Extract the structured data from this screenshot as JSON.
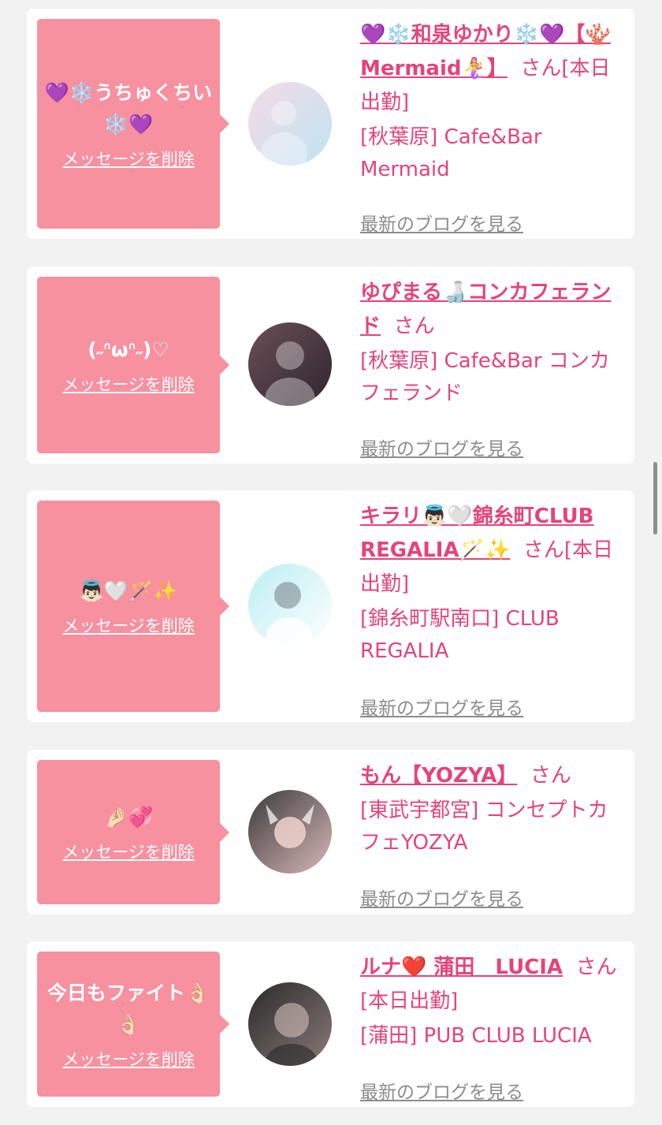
{
  "delete_label": "メッセージを削除",
  "blog_label": "最新のブログを見る",
  "items": [
    {
      "message": "💜❄️うちゅくちい❄️💜",
      "name": "💜❄️和泉ゆかり❄️💜【🪸Mermaid🧜‍♀️】",
      "suffix": "さん[本日出勤]",
      "shop": "[秋葉原] Cafe&Bar Mermaid"
    },
    {
      "message": "(˶ᐢωᐢ˶)♡",
      "name": "ゆぴまる🍶コンカフェランド",
      "suffix": "さん",
      "shop": "[秋葉原] Cafe&Bar コンカフェランド"
    },
    {
      "message": "👼🏻🤍🪄✨",
      "name": "キラリ👼🏻🤍錦糸町CLUB REGALIA🪄✨",
      "suffix": "さん[本日出勤]",
      "shop": "[錦糸町駅南口] CLUB REGALIA"
    },
    {
      "message": "🤌🏻💞",
      "name": "もん【YOZYA】",
      "suffix": "さん",
      "shop": "[東武宇都宮] コンセプトカフェYOZYA"
    },
    {
      "message": "今日もファイト👌🏻👌🏻",
      "name": "ルナ❤️ 蒲田　LUCIA",
      "suffix": "さん[本日出勤]",
      "shop": "[蒲田] PUB CLUB LUCIA"
    }
  ],
  "colors": {
    "bubble": "#f7909f",
    "accent": "#e4447a",
    "background": "#f2f2f2"
  }
}
